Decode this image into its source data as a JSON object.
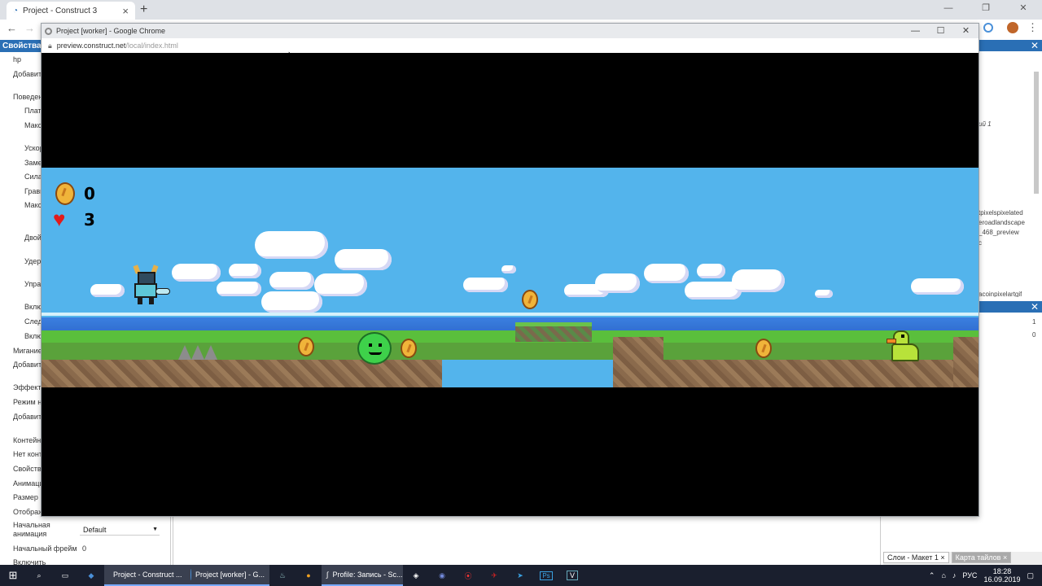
{
  "browser": {
    "tab_title": "Project - Construct 3",
    "tab_close": "×",
    "new_tab": "+",
    "back": "←",
    "forward": "→",
    "win_min": "—",
    "win_max": "❐",
    "win_close": "✕"
  },
  "editor": {
    "properties_header": "Свойства",
    "property_rows": [
      "hp",
      "Добавить редактир",
      "Поведение",
      "Платформа",
      "Макс. скорость",
      "Ускорение",
      "Замедление",
      "Сила прыжка",
      "Гравитация",
      "Макс. скорость падения",
      "Двойной прыжок",
      "Удерж. прыжок",
      "Управление по умолч.",
      "Включено",
      "Следовать",
      "Включено",
      "Мигание",
      "Добавить редактир",
      "Эффекты",
      "Режим наложения",
      "Добавить редактир",
      "Контейнер",
      "Нет контейнера",
      "Свойства",
      "Анимация",
      "Размер",
      "Отображение"
    ],
    "initial_animation_label": "Начальная анимация",
    "initial_animation_value": "Default",
    "initial_frame_label": "Начальный фрейм",
    "initial_frame_value": "0",
    "enable_label": "Включить",
    "right_panel_texts": [
      "ий 1",
      "tpixelspixelated",
      "eroadlandscape",
      "_468_preview",
      "c",
      "acoinpixelartgif"
    ],
    "right_panel_numbers": [
      "1",
      "0"
    ],
    "bottom_tabs": [
      "Слои - Макет 1",
      "Карта тайлов"
    ],
    "bottom_tab_close": "×"
  },
  "popup": {
    "title": "Project [worker] - Google Chrome",
    "url_host": "preview.construct.net",
    "url_path": "/local/index.html",
    "min": "—",
    "max": "☐",
    "close": "✕"
  },
  "game": {
    "coins": "0",
    "lives": "3"
  },
  "taskbar": {
    "items": [
      {
        "label": "Project - Construct ...",
        "color": "#e74c3c"
      },
      {
        "label": "Project [worker] - G...",
        "color": "#4a90d9"
      },
      {
        "label": "Profile: Запись - Sc...",
        "color": "#ffffff"
      }
    ],
    "lang": "РУС",
    "time": "18:28",
    "date": "16.09.2019"
  }
}
